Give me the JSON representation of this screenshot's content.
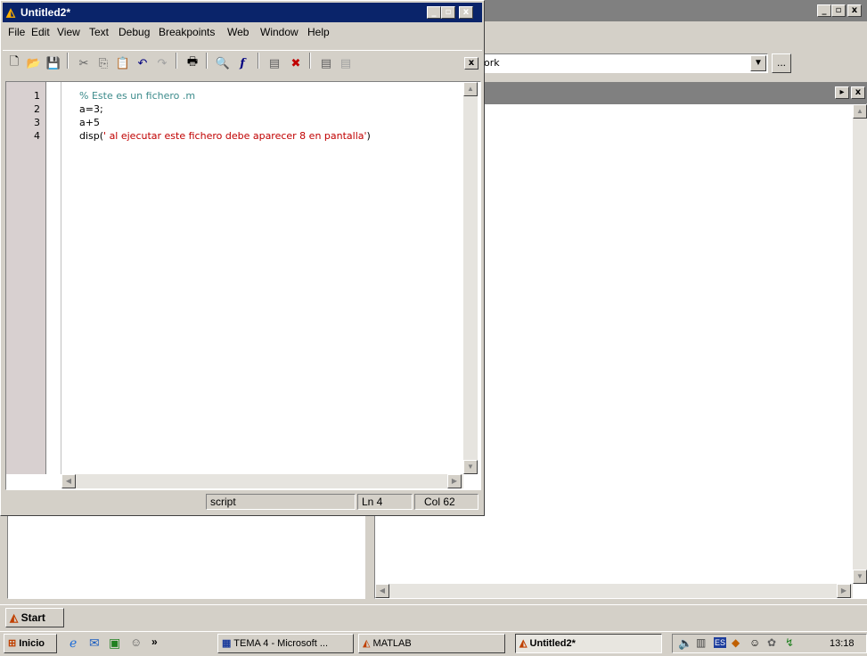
{
  "bg_window": {
    "title_buttons": [
      "_",
      "▫",
      "x"
    ],
    "path_value": "ork",
    "browse_label": "...",
    "panel_buttons": [
      "▸",
      "x"
    ]
  },
  "editor": {
    "title": "Untitled2*",
    "menu": [
      "File",
      "Edit",
      "View",
      "Text",
      "Debug",
      "Breakpoints",
      "Web",
      "Window",
      "Help"
    ],
    "lines": [
      {
        "num": "1",
        "text": "% Este es un fichero .m",
        "color": "#3c8b8b"
      },
      {
        "num": "2",
        "text": "a=3;",
        "color": "#000000"
      },
      {
        "num": "3",
        "text": "a+5",
        "color": "#000000"
      }
    ],
    "line4": {
      "num": "4",
      "prefix": "disp(",
      "string": "' al ejecutar este fichero debe aparecer 8 en pantalla'",
      "suffix": ")"
    },
    "status": {
      "mode": "script",
      "ln": "Ln 4",
      "col": "Col 62"
    },
    "colors": {
      "comment": "#3c8b8b",
      "string": "#a020f0",
      "title_bg": "#0a246a"
    }
  },
  "taskbar_top": {
    "start_label": "Start"
  },
  "taskbar": {
    "start_label": "Inicio",
    "chevron": "»",
    "tasks": [
      "TEMA 4 - Microsoft ...",
      "MATLAB",
      "Untitled2*"
    ],
    "clock": "13:18",
    "lang": "ES"
  }
}
